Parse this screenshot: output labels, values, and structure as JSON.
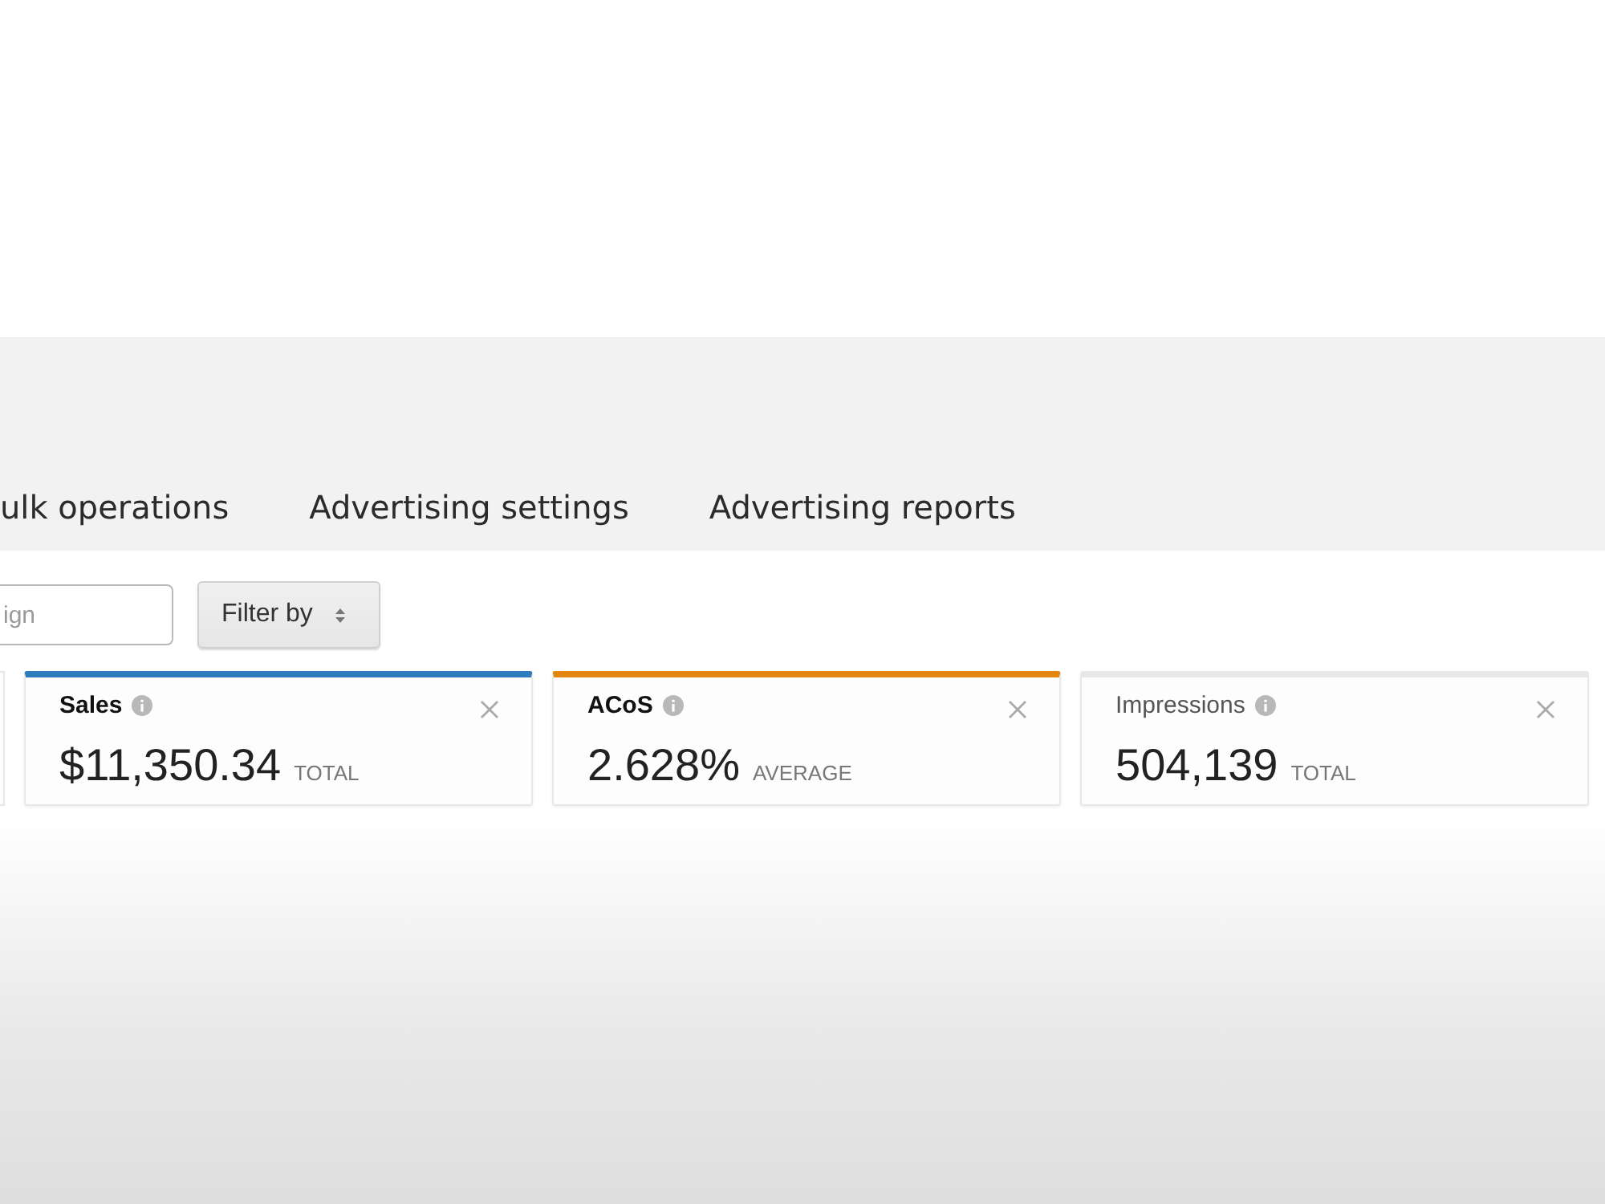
{
  "tabs": [
    {
      "label": "ulk operations",
      "selected": false
    },
    {
      "label": "Advertising settings",
      "selected": false
    },
    {
      "label": "Advertising reports",
      "selected": false
    }
  ],
  "search": {
    "placeholder": "ign"
  },
  "filter_button": {
    "label": "Filter by"
  },
  "metric_cards": [
    {
      "title": "Sales",
      "value": "$11,350.34",
      "aggregate": "TOTAL",
      "selected": true,
      "color": "#2f7bbf"
    },
    {
      "title": "ACoS",
      "value": "2.628%",
      "aggregate": "AVERAGE",
      "selected": true,
      "color": "#e3860f"
    },
    {
      "title": "Impressions",
      "value": "504,139",
      "aggregate": "TOTAL",
      "selected": false
    }
  ]
}
